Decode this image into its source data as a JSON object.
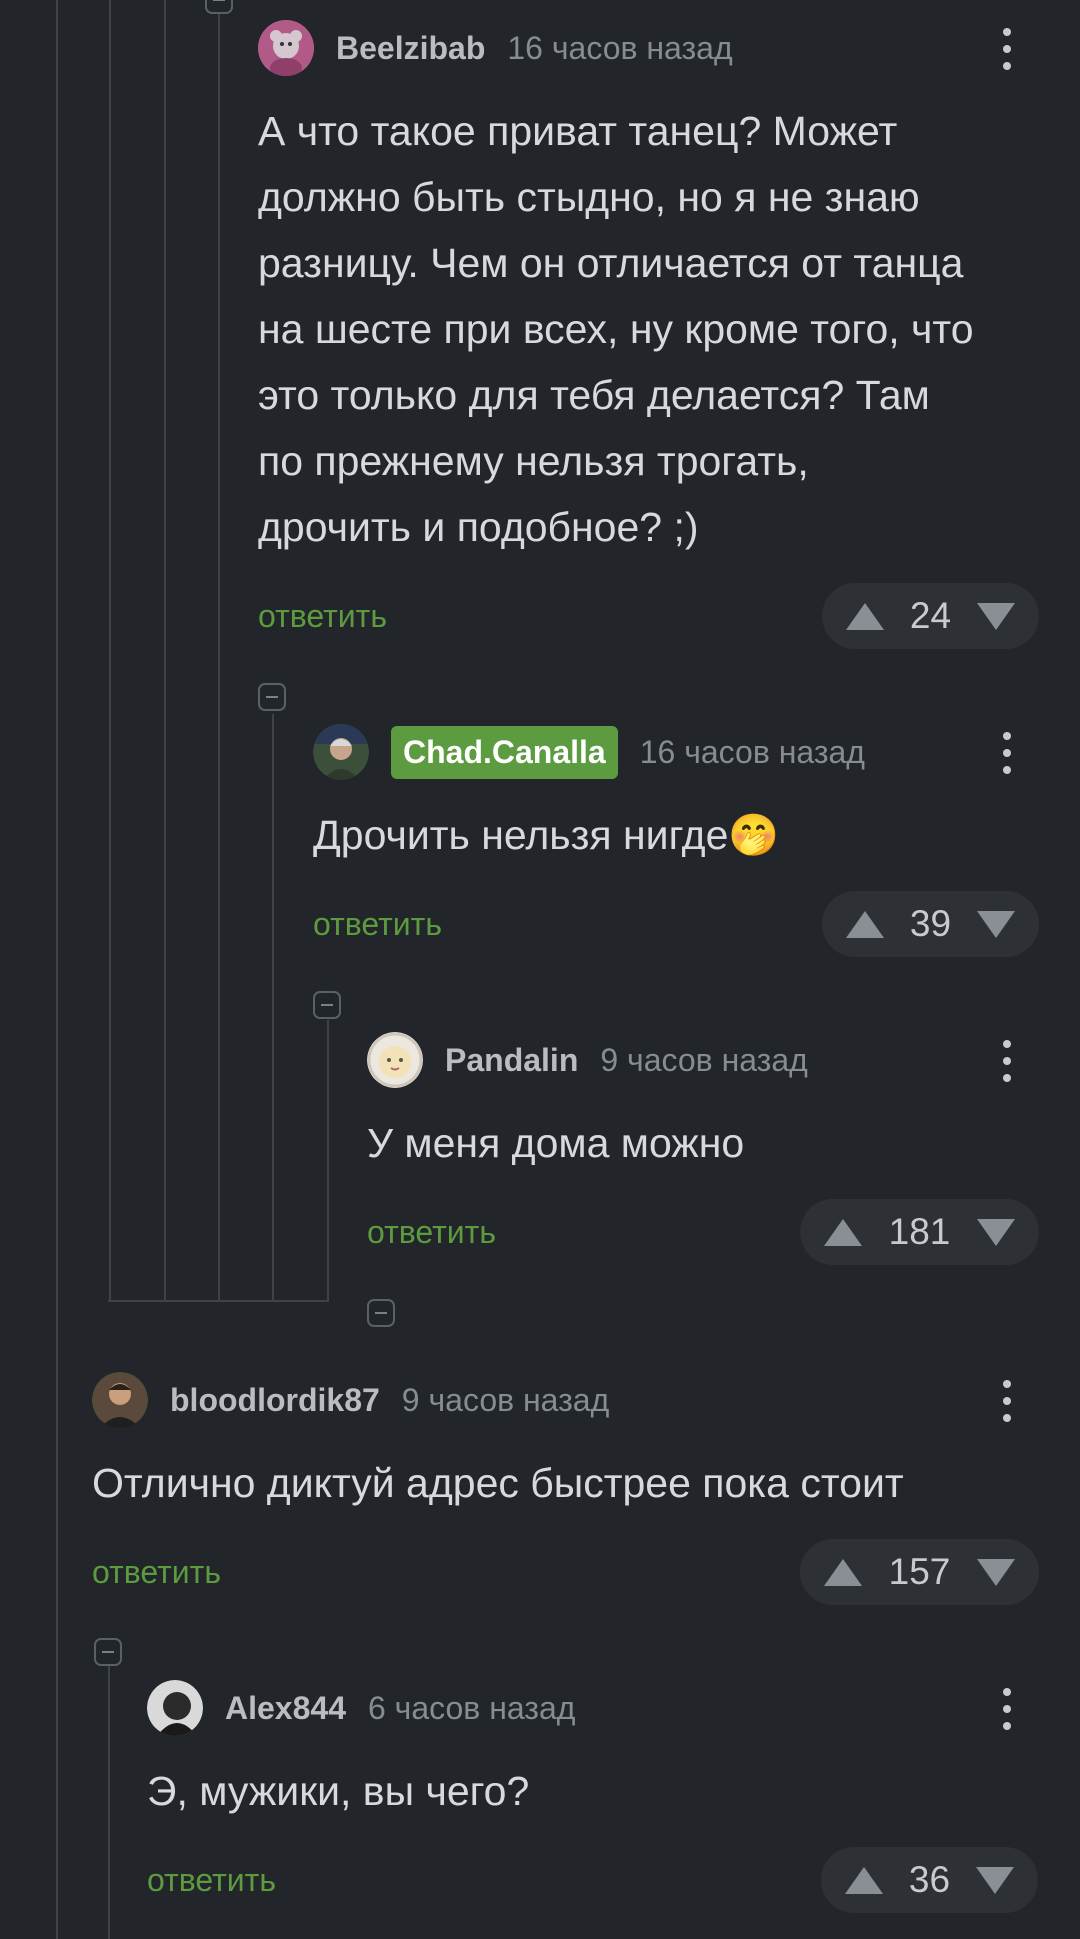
{
  "comments": [
    {
      "author": "Beelzibab",
      "time": "16 часов назад",
      "lines": [
        "А что такое приват танец? Может",
        "должно быть стыдно, но я не знаю",
        "разницу. Чем он отличается от танца",
        "на шесте при всех, ну кроме того, что",
        "это только для тебя делается? Там",
        "по прежнему нельзя трогать,",
        "дрочить и подобное? ;)"
      ],
      "reply": "ответить",
      "rating": "24"
    },
    {
      "author": "Chad.Canalla",
      "time": "16 часов назад",
      "lines": [
        "Дрочить нельзя нигде🤭"
      ],
      "reply": "ответить",
      "rating": "39",
      "author_badge_color": "#5c9b3f"
    },
    {
      "author": "Pandalin",
      "time": "9 часов назад",
      "lines": [
        "У меня дома можно"
      ],
      "reply": "ответить",
      "rating": "181"
    },
    {
      "author": "bloodlordik87",
      "time": "9 часов назад",
      "lines": [
        "Отлично диктуй адрес быстрее пока стоит"
      ],
      "reply": "ответить",
      "rating": "157"
    },
    {
      "author": "Alex844",
      "time": "6 часов назад",
      "lines": [
        "Э, мужики, вы чего?"
      ],
      "reply": "ответить",
      "rating": "36"
    }
  ],
  "icons": {
    "upvote": "triangle-up-icon",
    "downvote": "triangle-down-icon",
    "menu": "kebab-menu-icon",
    "collapse": "collapse-minus-icon"
  },
  "colors": {
    "background": "#222529",
    "reply_link": "#5c9b3f",
    "thread_line": "#3f4349",
    "rating_pill": "#2d3035"
  }
}
